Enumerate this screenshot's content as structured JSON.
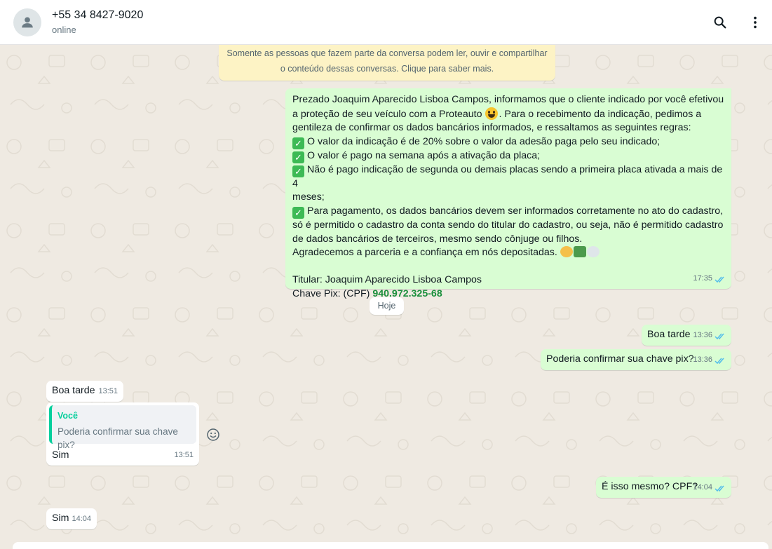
{
  "header": {
    "contact_name": "+55 34 8427-9020",
    "contact_status": "online",
    "search_icon": "search-icon",
    "menu_icon": "more-vertical-icon"
  },
  "encryption_notice": {
    "line1": "Somente as pessoas que fazem parte da conversa podem ler, ouvir e compartilhar",
    "line2": "o conteúdo dessas conversas. Clique para saber mais."
  },
  "messages": {
    "m1": {
      "l1": "Prezado Joaquim Aparecido Lisboa Campos, informamos que o cliente indicado por você efetivou",
      "l2a": "a proteção de seu veículo com a Proteauto ",
      "l2b": ". Para o recebimento da indicação, pedimos a",
      "l3": "gentileza de confirmar os dados bancários informados, e  ressaltamos as seguintes regras:",
      "r1": "O valor da indicação é de 20% sobre o valor da adesão paga pelo seu indicado;",
      "r2": "O valor é pago na semana após a ativação da placa;",
      "r3a": "Não é pago indicação de segunda ou demais placas sendo a primeira placa ativada a mais de 4",
      "r3b": "meses;",
      "r4a": "Para pagamento, os dados bancários devem ser informados corretamente no ato do cadastro,",
      "r4b": "só é permitido o cadastro da conta sendo do titular do cadastro, ou seja, não é permitido cadastro",
      "r4c": "de dados bancários de terceiros, mesmo sendo cônjuge ou filhos.",
      "thanks": "Agradecemos a parceria e a confiança em nós depositadas. ",
      "titular": "Titular: Joaquim Aparecido Lisboa Campos",
      "pix_label": "Chave Pix: (CPF) ",
      "pix_value": "940.972.325-68",
      "time": "17:35"
    },
    "date_chip": "Hoje",
    "m2": {
      "text": "Boa tarde",
      "time": "13:36"
    },
    "m3": {
      "text": "Poderia confirmar sua chave pix?",
      "time": "13:36"
    },
    "m4": {
      "text": "Boa tarde",
      "time": "13:51"
    },
    "m5": {
      "quote_author": "Você",
      "quote_text": "Poderia confirmar sua chave pix?",
      "text": "Sim",
      "time": "13:51"
    },
    "m6": {
      "text": "É isso mesmo? CPF?",
      "time": "14:04"
    },
    "m7": {
      "text": "Sim",
      "time": "14:04"
    }
  },
  "colors": {
    "outgoing_bubble": "#d9fdd3",
    "incoming_bubble": "#ffffff",
    "read_ticks": "#53bdeb",
    "accent": "#06cf9c"
  }
}
